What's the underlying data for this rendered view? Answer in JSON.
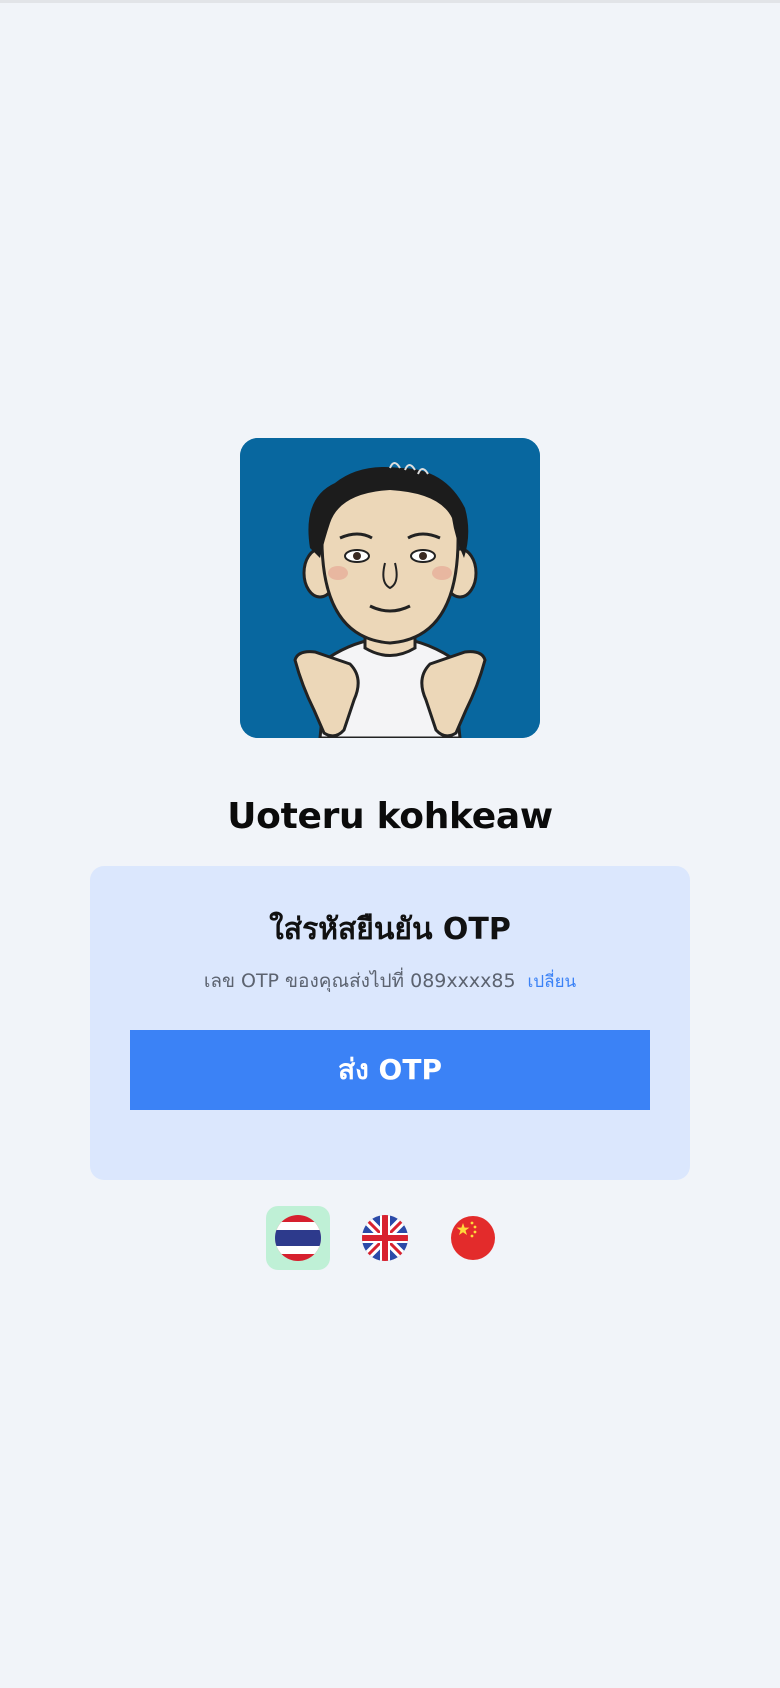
{
  "profile": {
    "name": "Uoteru kohkeaw",
    "avatar_icon": "cartoon-man-avatar"
  },
  "otp": {
    "title": "ใส่รหัสยืนยัน OTP",
    "sent_to_text": "เลข OTP ของคุณส่งไปที่ 089xxxx85",
    "change_link": "เปลี่ยน",
    "send_button": "ส่ง OTP"
  },
  "languages": [
    {
      "code": "th",
      "icon": "thailand-flag-icon",
      "selected": true
    },
    {
      "code": "en",
      "icon": "uk-flag-icon",
      "selected": false
    },
    {
      "code": "zh",
      "icon": "china-flag-icon",
      "selected": false
    }
  ],
  "colors": {
    "background": "#f1f4f9",
    "avatar_bg": "#08679f",
    "card_bg": "#dbe7fd",
    "primary": "#3b82f6",
    "selected_lang_bg": "#bff0d6"
  }
}
